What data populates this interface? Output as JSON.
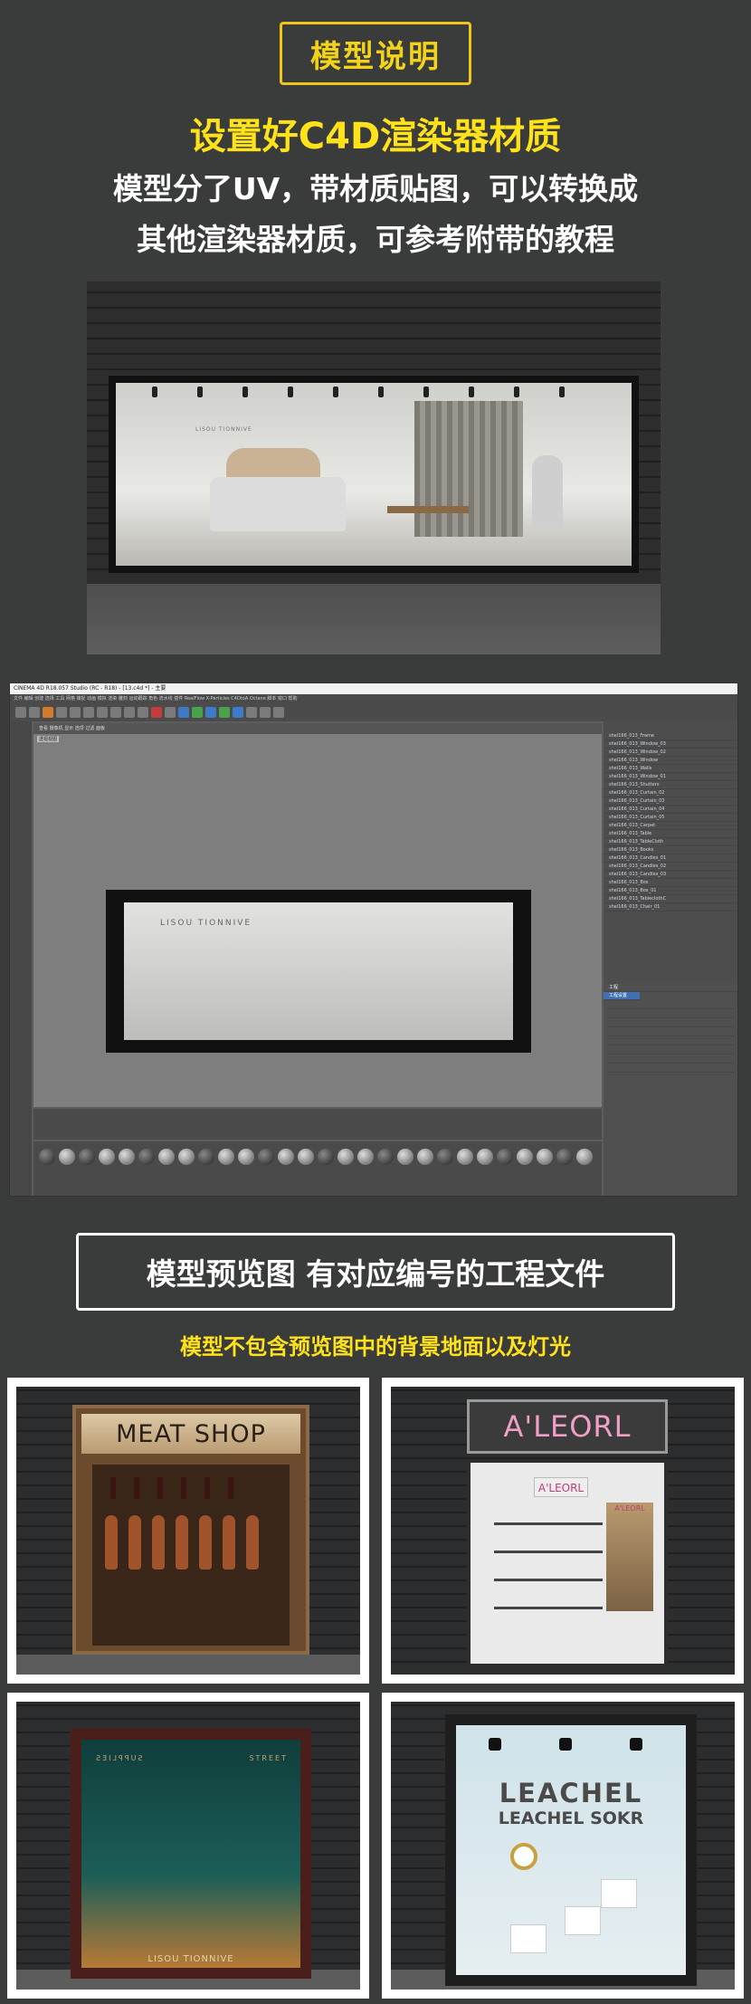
{
  "header": {
    "badge": "模型说明",
    "headline": "设置好C4D渲染器材质",
    "line1": "模型分了UV，带材质贴图，可以转换成",
    "line2": "其他渲染器材质，可参考附带的教程"
  },
  "render1": {
    "brand": "LISOU TIONNIVE"
  },
  "c4d": {
    "title": "CINEMA 4D R18.057 Studio (RC - R18) - [13.c4d *] - 主要",
    "menu": "文件  编辑  创建  选择  工具  网格  捕捉  动画  模拟  渲染  雕刻  运动跟踪  角色  流水线  插件  RealFlow  X-Particles  C4DtoA  Octane  脚本  窗口  帮助",
    "viewport_menu": "查看  摄像机  显示  选项  过滤  面板",
    "viewport_label": "透视视图",
    "scene_label": "LISOU TIONNIVE",
    "objects": [
      "shel166_013_Frame",
      "shel166_013_Window_03",
      "shel166_013_Window_02",
      "shel166_013_Window",
      "shel166_013_Walls",
      "shel166_013_Window_01",
      "shel166_013_Shutters",
      "shel166_013_Curtain_02",
      "shel166_013_Curtain_03",
      "shel166_013_Curtain_04",
      "shel166_013_Curtain_05",
      "shel166_013_Carpet",
      "shel166_013_Table",
      "shel166_013_TableCloth",
      "shel166_013_Books",
      "shel166_013_Candles_01",
      "shel166_013_Candles_02",
      "shel166_013_Candles_03",
      "shel166_013_Box",
      "shel166_013_Box_01",
      "shel166_013_TableclothC",
      "shel166_013_Chair_01"
    ],
    "attr_title": "工程",
    "attr_tab": "工程设置"
  },
  "section2": {
    "box": "模型预览图  有对应编号的工程文件",
    "sub": "模型不包含预览图中的背景地面以及灯光"
  },
  "cards": {
    "meat": "MEAT SHOP",
    "aleorl": "A'LEORL",
    "aleorl_small": "A'LEORL",
    "supplies": "SUPPLIES",
    "street": "STREET",
    "lisou": "LISOU TIONNIVE",
    "leachel": "LEACHEL",
    "leachel2": "LEACHEL SOKR"
  },
  "colors": {
    "background": "#3a3b3b",
    "accent_yellow": "#ffe21a",
    "badge_border": "#f0c419"
  }
}
